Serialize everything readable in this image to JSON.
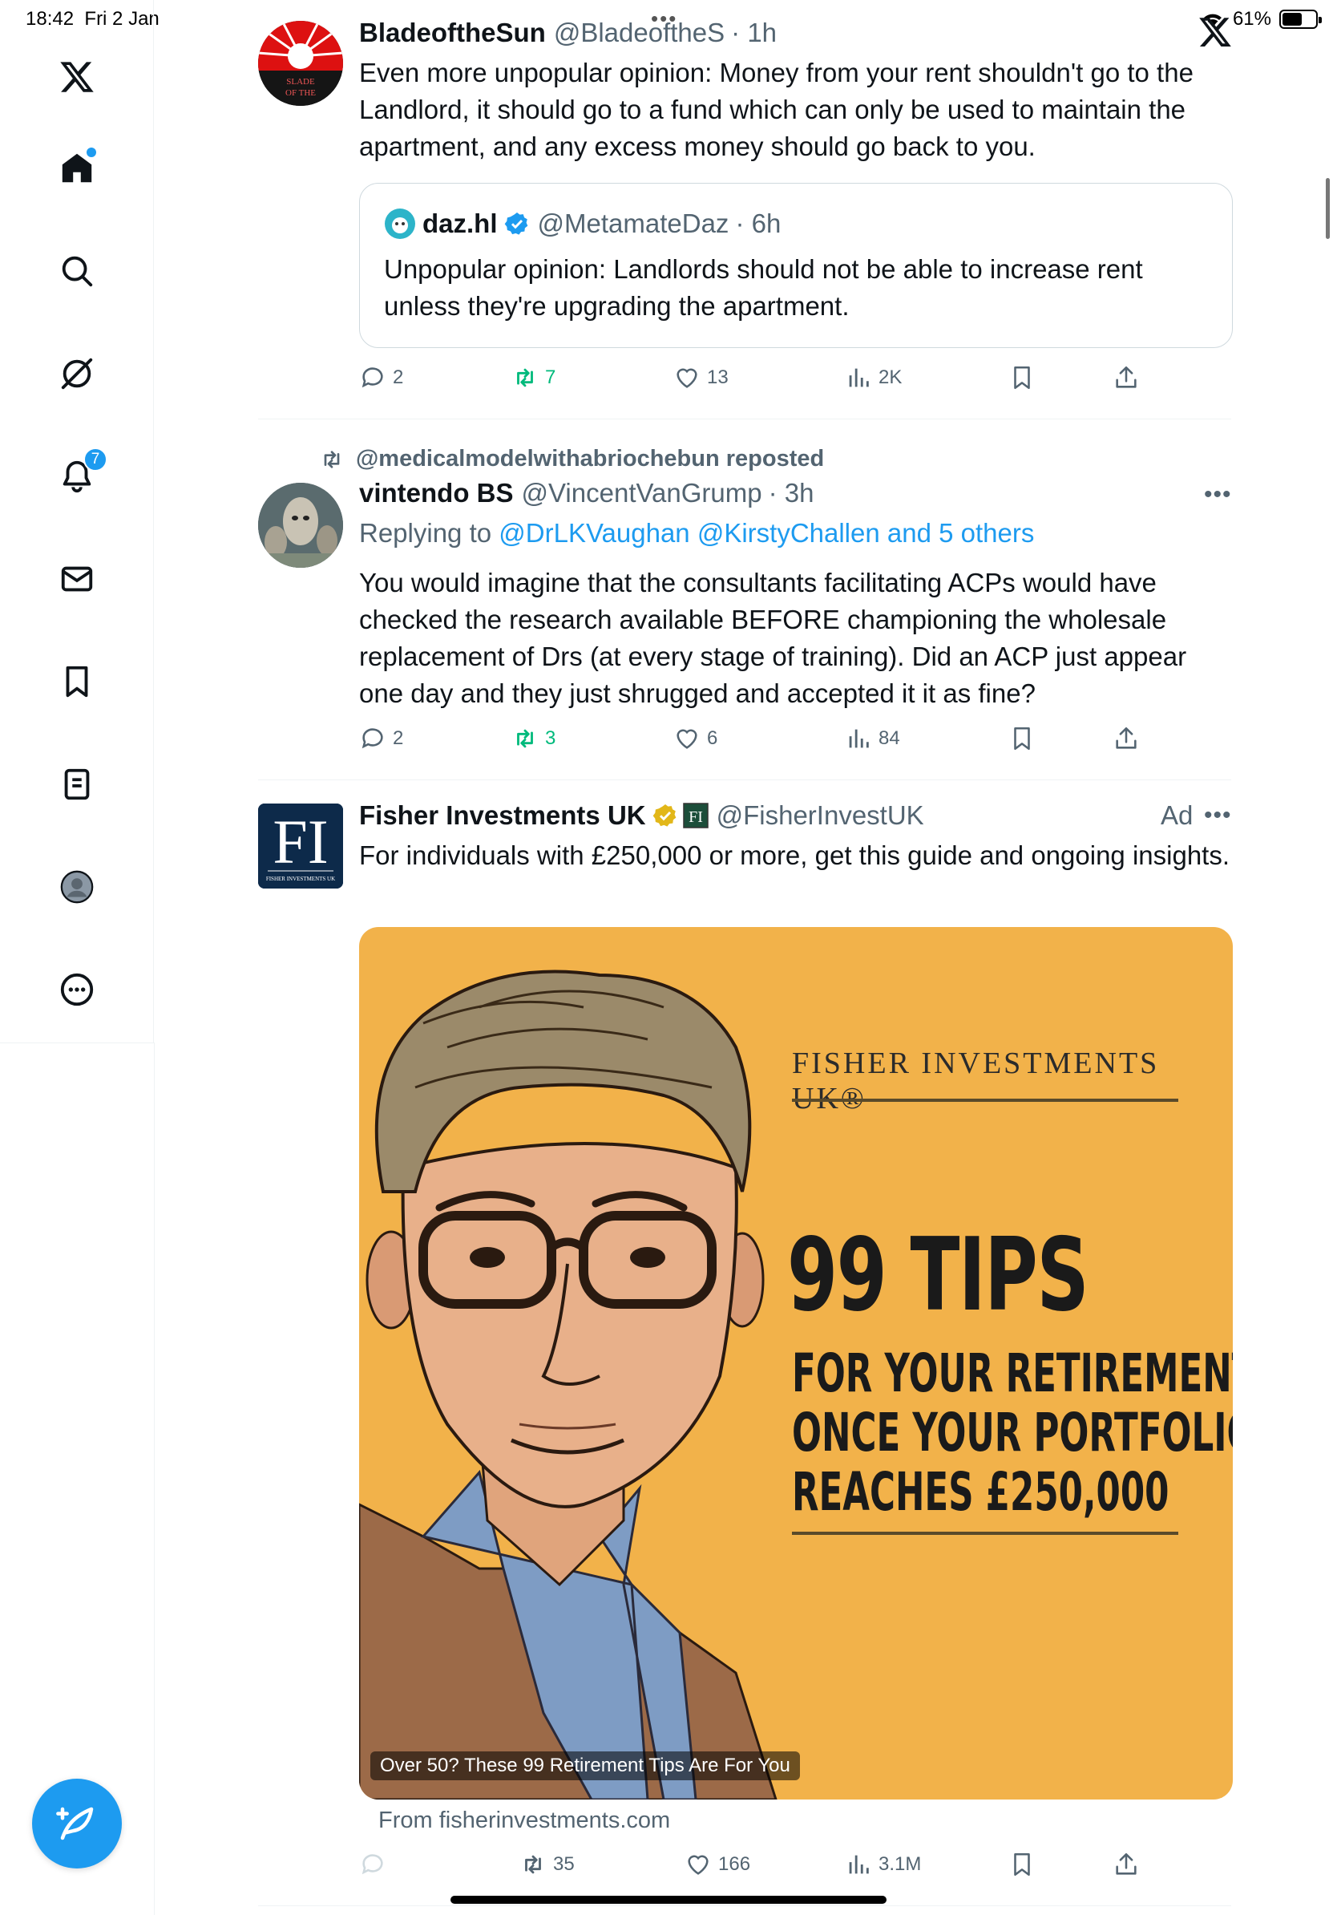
{
  "status_bar": {
    "time": "18:42",
    "date": "Fri 2 Jan",
    "battery_percent": "61%",
    "battery_level": 0.61
  },
  "nav": {
    "items": [
      "x-logo",
      "home",
      "search",
      "grok",
      "notifications",
      "messages",
      "bookmarks",
      "lists",
      "profile",
      "more"
    ],
    "notifications_count": "7"
  },
  "tweets": [
    {
      "name": "BladeoftheSun",
      "handle": "@BladeoftheS",
      "time": "· 1h",
      "avatar_text": "SLADE OF THE SUN",
      "text": "Even more unpopular opinion: Money from your rent shouldn't go to the Landlord, it should go to a fund which can only be used to maintain the apartment, and any excess money should go back to you.",
      "quote": {
        "name": "daz.hl",
        "handle": "@MetamateDaz",
        "time": "· 6h",
        "text": "Unpopular opinion: Landlords should not be able to increase rent unless they're upgrading the apartment."
      },
      "stats": {
        "replies": "2",
        "reposts": "7",
        "likes": "13",
        "views": "2K"
      }
    },
    {
      "repost_by": "@medicalmodelwithabriochebun reposted",
      "name": "vintendo BS",
      "handle": "@VincentVanGrump",
      "time": "· 3h",
      "replying_prefix": "Replying to",
      "replying_to": "@DrLKVaughan @KirstyChallen and 5 others",
      "text": "You would imagine that the consultants facilitating ACPs would have checked the research available BEFORE championing the wholesale replacement of Drs (at every stage of training). Did an ACP just appear one day and they just shrugged and accepted it it as fine?",
      "stats": {
        "replies": "2",
        "reposts": "3",
        "likes": "6",
        "views": "84"
      }
    },
    {
      "name": "Fisher Investments UK",
      "handle": "@FisherInvestUK",
      "ad_label": "Ad",
      "avatar_text": "FI",
      "avatar_subtext": "FISHER INVESTMENTS UK",
      "text": "For individuals with £250,000 or more, get this guide and ongoing insights.",
      "ad_image": {
        "brand": "FISHER INVESTMENTS UK®",
        "headline": "99 TIPS",
        "sub_lines": [
          "FOR YOUR RETIREMENT",
          "ONCE YOUR PORTFOLIO",
          "REACHES £250,000"
        ],
        "caption": "Over 50? These 99 Retirement Tips Are For You"
      },
      "from": "From fisherinvestments.com",
      "stats": {
        "reposts": "35",
        "likes": "166",
        "views": "3.1M"
      }
    }
  ],
  "colors": {
    "accent": "#1d9bf0",
    "repost_green": "#00ba7c",
    "ad_bg": "#f2b24a",
    "muted": "#536471"
  }
}
